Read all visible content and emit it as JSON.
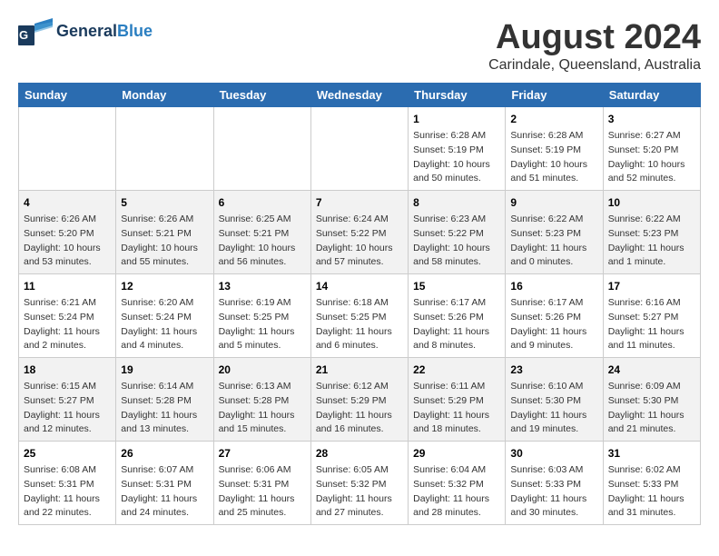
{
  "header": {
    "logo_general": "General",
    "logo_blue": "Blue",
    "month": "August 2024",
    "location": "Carindale, Queensland, Australia"
  },
  "weekdays": [
    "Sunday",
    "Monday",
    "Tuesday",
    "Wednesday",
    "Thursday",
    "Friday",
    "Saturday"
  ],
  "weeks": [
    [
      {
        "day": "",
        "info": ""
      },
      {
        "day": "",
        "info": ""
      },
      {
        "day": "",
        "info": ""
      },
      {
        "day": "",
        "info": ""
      },
      {
        "day": "1",
        "info": "Sunrise: 6:28 AM\nSunset: 5:19 PM\nDaylight: 10 hours\nand 50 minutes."
      },
      {
        "day": "2",
        "info": "Sunrise: 6:28 AM\nSunset: 5:19 PM\nDaylight: 10 hours\nand 51 minutes."
      },
      {
        "day": "3",
        "info": "Sunrise: 6:27 AM\nSunset: 5:20 PM\nDaylight: 10 hours\nand 52 minutes."
      }
    ],
    [
      {
        "day": "4",
        "info": "Sunrise: 6:26 AM\nSunset: 5:20 PM\nDaylight: 10 hours\nand 53 minutes."
      },
      {
        "day": "5",
        "info": "Sunrise: 6:26 AM\nSunset: 5:21 PM\nDaylight: 10 hours\nand 55 minutes."
      },
      {
        "day": "6",
        "info": "Sunrise: 6:25 AM\nSunset: 5:21 PM\nDaylight: 10 hours\nand 56 minutes."
      },
      {
        "day": "7",
        "info": "Sunrise: 6:24 AM\nSunset: 5:22 PM\nDaylight: 10 hours\nand 57 minutes."
      },
      {
        "day": "8",
        "info": "Sunrise: 6:23 AM\nSunset: 5:22 PM\nDaylight: 10 hours\nand 58 minutes."
      },
      {
        "day": "9",
        "info": "Sunrise: 6:22 AM\nSunset: 5:23 PM\nDaylight: 11 hours\nand 0 minutes."
      },
      {
        "day": "10",
        "info": "Sunrise: 6:22 AM\nSunset: 5:23 PM\nDaylight: 11 hours\nand 1 minute."
      }
    ],
    [
      {
        "day": "11",
        "info": "Sunrise: 6:21 AM\nSunset: 5:24 PM\nDaylight: 11 hours\nand 2 minutes."
      },
      {
        "day": "12",
        "info": "Sunrise: 6:20 AM\nSunset: 5:24 PM\nDaylight: 11 hours\nand 4 minutes."
      },
      {
        "day": "13",
        "info": "Sunrise: 6:19 AM\nSunset: 5:25 PM\nDaylight: 11 hours\nand 5 minutes."
      },
      {
        "day": "14",
        "info": "Sunrise: 6:18 AM\nSunset: 5:25 PM\nDaylight: 11 hours\nand 6 minutes."
      },
      {
        "day": "15",
        "info": "Sunrise: 6:17 AM\nSunset: 5:26 PM\nDaylight: 11 hours\nand 8 minutes."
      },
      {
        "day": "16",
        "info": "Sunrise: 6:17 AM\nSunset: 5:26 PM\nDaylight: 11 hours\nand 9 minutes."
      },
      {
        "day": "17",
        "info": "Sunrise: 6:16 AM\nSunset: 5:27 PM\nDaylight: 11 hours\nand 11 minutes."
      }
    ],
    [
      {
        "day": "18",
        "info": "Sunrise: 6:15 AM\nSunset: 5:27 PM\nDaylight: 11 hours\nand 12 minutes."
      },
      {
        "day": "19",
        "info": "Sunrise: 6:14 AM\nSunset: 5:28 PM\nDaylight: 11 hours\nand 13 minutes."
      },
      {
        "day": "20",
        "info": "Sunrise: 6:13 AM\nSunset: 5:28 PM\nDaylight: 11 hours\nand 15 minutes."
      },
      {
        "day": "21",
        "info": "Sunrise: 6:12 AM\nSunset: 5:29 PM\nDaylight: 11 hours\nand 16 minutes."
      },
      {
        "day": "22",
        "info": "Sunrise: 6:11 AM\nSunset: 5:29 PM\nDaylight: 11 hours\nand 18 minutes."
      },
      {
        "day": "23",
        "info": "Sunrise: 6:10 AM\nSunset: 5:30 PM\nDaylight: 11 hours\nand 19 minutes."
      },
      {
        "day": "24",
        "info": "Sunrise: 6:09 AM\nSunset: 5:30 PM\nDaylight: 11 hours\nand 21 minutes."
      }
    ],
    [
      {
        "day": "25",
        "info": "Sunrise: 6:08 AM\nSunset: 5:31 PM\nDaylight: 11 hours\nand 22 minutes."
      },
      {
        "day": "26",
        "info": "Sunrise: 6:07 AM\nSunset: 5:31 PM\nDaylight: 11 hours\nand 24 minutes."
      },
      {
        "day": "27",
        "info": "Sunrise: 6:06 AM\nSunset: 5:31 PM\nDaylight: 11 hours\nand 25 minutes."
      },
      {
        "day": "28",
        "info": "Sunrise: 6:05 AM\nSunset: 5:32 PM\nDaylight: 11 hours\nand 27 minutes."
      },
      {
        "day": "29",
        "info": "Sunrise: 6:04 AM\nSunset: 5:32 PM\nDaylight: 11 hours\nand 28 minutes."
      },
      {
        "day": "30",
        "info": "Sunrise: 6:03 AM\nSunset: 5:33 PM\nDaylight: 11 hours\nand 30 minutes."
      },
      {
        "day": "31",
        "info": "Sunrise: 6:02 AM\nSunset: 5:33 PM\nDaylight: 11 hours\nand 31 minutes."
      }
    ]
  ]
}
